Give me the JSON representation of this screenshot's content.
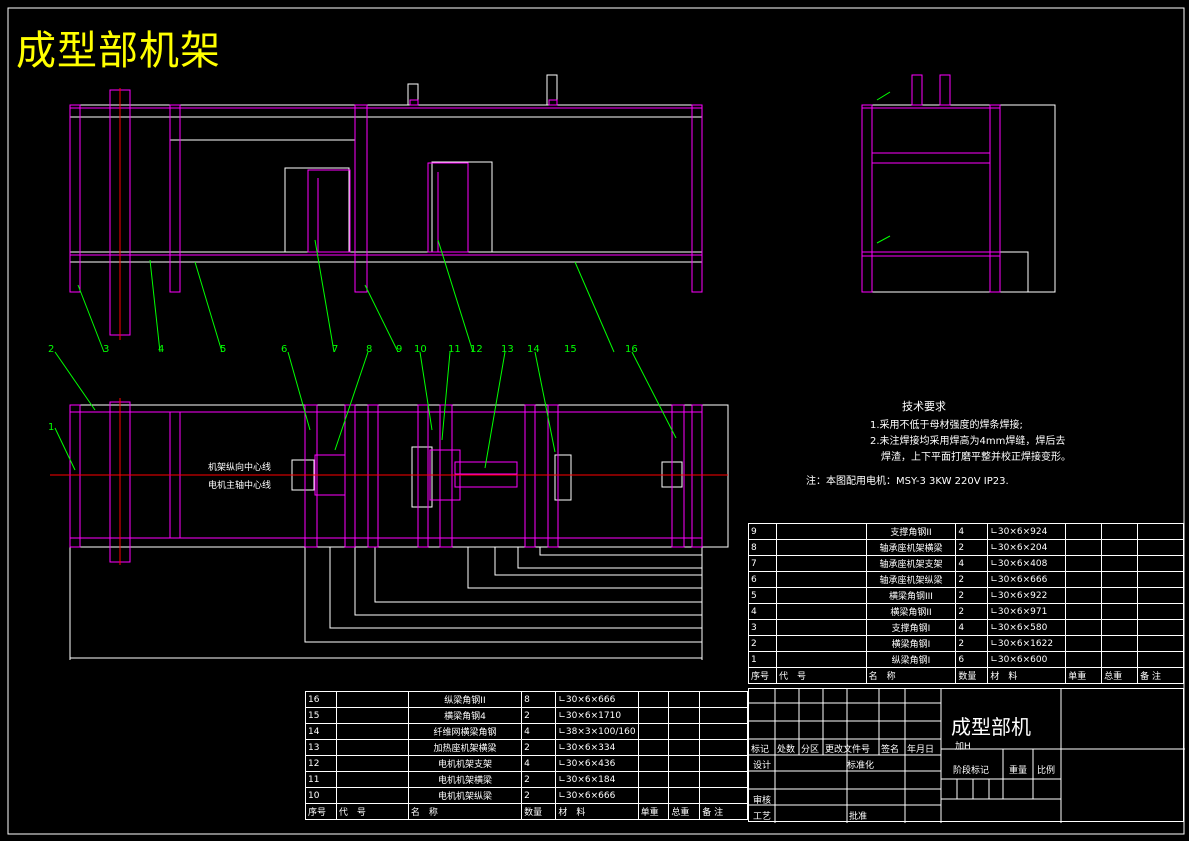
{
  "drawing_title": "成型部机架",
  "part_numbers": [
    "1",
    "2",
    "3",
    "4",
    "5",
    "6",
    "7",
    "8",
    "9",
    "10",
    "11",
    "12",
    "13",
    "14",
    "15",
    "16"
  ],
  "center_lines": [
    "机架纵向中心线",
    "电机主轴中心线"
  ],
  "tech_req": {
    "heading": "技术要求",
    "line1": "1.采用不低于母材强度的焊条焊接;",
    "line2": "2.未注焊接均采用焊高为4mm焊缝，焊后去",
    "line3": "焊渣，上下平面打磨平整并校正焊接变形。",
    "note": "注：本图配用电机：MSY-3  3KW  220V  IP23."
  },
  "bom_right": {
    "rows": [
      {
        "no": "9",
        "name": "支撑角钢II",
        "qty": "4",
        "material": "∟30×6×924"
      },
      {
        "no": "8",
        "name": "轴承座机架横梁",
        "qty": "2",
        "material": "∟30×6×204"
      },
      {
        "no": "7",
        "name": "轴承座机架支架",
        "qty": "4",
        "material": "∟30×6×408"
      },
      {
        "no": "6",
        "name": "轴承座机架纵梁",
        "qty": "2",
        "material": "∟30×6×666"
      },
      {
        "no": "5",
        "name": "横梁角钢III",
        "qty": "2",
        "material": "∟30×6×922"
      },
      {
        "no": "4",
        "name": "横梁角钢II",
        "qty": "2",
        "material": "∟30×6×971"
      },
      {
        "no": "3",
        "name": "支撑角钢I",
        "qty": "4",
        "material": "∟30×6×580"
      },
      {
        "no": "2",
        "name": "横梁角钢I",
        "qty": "2",
        "material": "∟30×6×1622"
      },
      {
        "no": "1",
        "name": "纵梁角钢I",
        "qty": "6",
        "material": "∟30×6×600"
      }
    ],
    "header": {
      "no": "序号",
      "code": "代　号",
      "name": "名　称",
      "qty": "数量",
      "material": "材　料",
      "unit_w": "单重",
      "total_w": "总重",
      "remark": "备 注"
    }
  },
  "bom_left": {
    "rows": [
      {
        "no": "16",
        "name": "纵梁角钢II",
        "qty": "8",
        "material": "∟30×6×666"
      },
      {
        "no": "15",
        "name": "横梁角钢4",
        "qty": "2",
        "material": "∟30×6×1710"
      },
      {
        "no": "14",
        "name": "纤维网横梁角钢",
        "qty": "4",
        "material": "∟38×3×100/160"
      },
      {
        "no": "13",
        "name": "加热座机架横梁",
        "qty": "2",
        "material": "∟30×6×334"
      },
      {
        "no": "12",
        "name": "电机机架支架",
        "qty": "4",
        "material": "∟30×6×436"
      },
      {
        "no": "11",
        "name": "电机机架横梁",
        "qty": "2",
        "material": "∟30×6×184"
      },
      {
        "no": "10",
        "name": "电机机架纵梁",
        "qty": "2",
        "material": "∟30×6×666"
      }
    ],
    "header": {
      "no": "序号",
      "code": "代　号",
      "name": "名　称",
      "qty": "数量",
      "material": "材　料",
      "unit_w": "单重",
      "total_w": "总重",
      "remark": "备 注"
    }
  },
  "title_block": {
    "name": "成型部机",
    "sub": "加H",
    "row_labels": [
      "标记",
      "处数",
      "分区",
      "更改文件号",
      "签名",
      "年月日"
    ],
    "design": "设计",
    "standard": "标准化",
    "review": "审核",
    "process": "工艺",
    "approve": "批准",
    "stage": "阶段标记",
    "weight": "重量",
    "scale": "比例"
  },
  "colors": {
    "frame": "#ff00ff",
    "leader": "#00ff00",
    "outline": "#ffffff",
    "centerline": "#ff0000",
    "title": "#ffff00"
  }
}
